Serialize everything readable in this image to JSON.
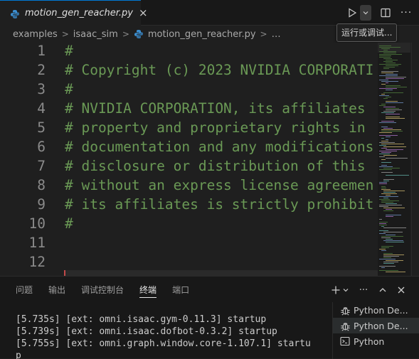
{
  "tab": {
    "label": "motion_gen_reacher.py",
    "close": "×"
  },
  "tooltip": "运行或调试...",
  "breadcrumb": {
    "items": [
      "examples",
      "isaac_sim",
      "motion_gen_reacher.py",
      "…"
    ],
    "separator": ">"
  },
  "editor": {
    "lines": [
      {
        "num": "1",
        "text": "#"
      },
      {
        "num": "2",
        "text": "# Copyright (c) 2023 NVIDIA CORPORATI"
      },
      {
        "num": "3",
        "text": "#"
      },
      {
        "num": "4",
        "text": "# NVIDIA CORPORATION, its affiliates"
      },
      {
        "num": "5",
        "text": "# property and proprietary rights in"
      },
      {
        "num": "6",
        "text": "# documentation and any modifications"
      },
      {
        "num": "7",
        "text": "# disclosure or distribution of this"
      },
      {
        "num": "8",
        "text": "# without an express license agreemen"
      },
      {
        "num": "9",
        "text": "# its affiliates is strictly prohibit"
      },
      {
        "num": "10",
        "text": "#"
      },
      {
        "num": "11",
        "text": ""
      },
      {
        "num": "12",
        "text": ""
      }
    ]
  },
  "panel": {
    "tabs": [
      "问题",
      "输出",
      "调试控制台",
      "终端",
      "端口"
    ],
    "active_tab": "终端",
    "more": "···",
    "terminal_lines": [
      "[5.735s] [ext: omni.isaac.gym-0.11.3] startup",
      "[5.739s] [ext: omni.isaac.dofbot-0.3.2] startup",
      "[5.755s] [ext: omni.graph.window.core-1.107.1] startu",
      "p"
    ],
    "terminals": [
      {
        "label": "Python De...",
        "icon": "debug-icon"
      },
      {
        "label": "Python De...",
        "icon": "debug-icon"
      },
      {
        "label": "Python",
        "icon": "terminal-icon"
      }
    ]
  },
  "colors": {
    "comment": "#6a9955",
    "accent": "#0078d4",
    "background": "#1f1f1f"
  }
}
